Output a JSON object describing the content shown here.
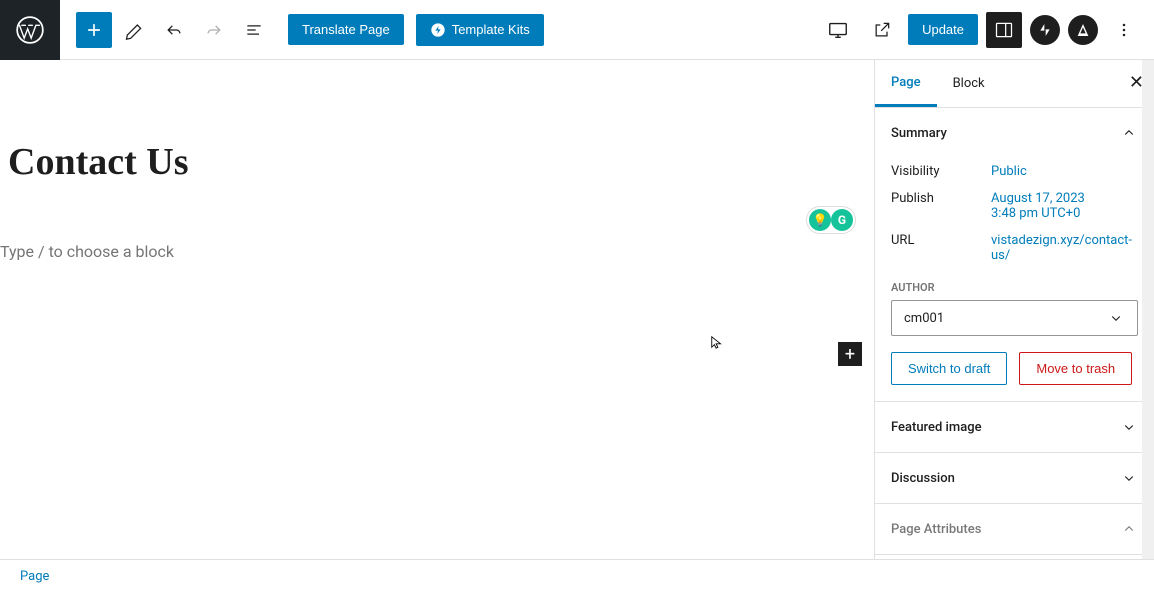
{
  "toolbar": {
    "translate_label": "Translate Page",
    "template_kits_label": "Template Kits",
    "update_label": "Update"
  },
  "editor": {
    "page_title": "Contact Us",
    "block_placeholder": "Type / to choose a block"
  },
  "sidebar": {
    "tabs": {
      "page": "Page",
      "block": "Block"
    },
    "panels": {
      "summary": {
        "title": "Summary",
        "visibility_label": "Visibility",
        "visibility_value": "Public",
        "publish_label": "Publish",
        "publish_value_line1": "August 17, 2023",
        "publish_value_line2": "3:48 pm UTC+0",
        "url_label": "URL",
        "url_value": "vistadezign.xyz/contact-us/",
        "author_label": "AUTHOR",
        "author_value": "cm001",
        "switch_draft": "Switch to draft",
        "move_trash": "Move to trash"
      },
      "featured_image": "Featured image",
      "discussion": "Discussion",
      "page_attributes": "Page Attributes"
    }
  },
  "footer": {
    "breadcrumb": "Page"
  }
}
